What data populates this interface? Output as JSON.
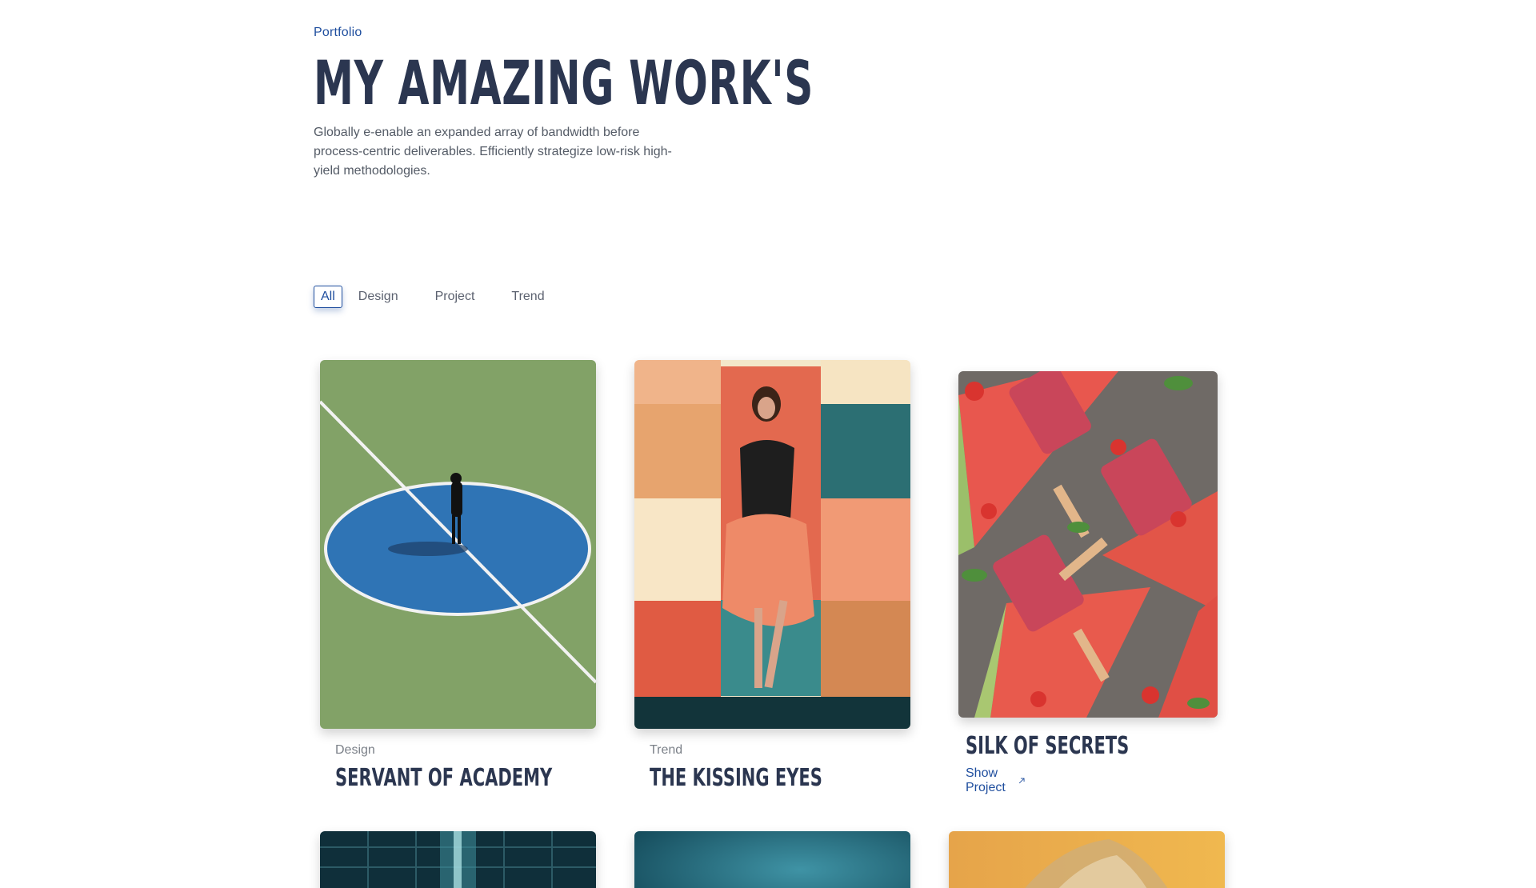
{
  "header": {
    "kicker": "Portfolio",
    "title": "MY AMAZING WORK'S",
    "description": "Globally e-enable an expanded array of bandwidth before process-centric deliverables. Efficiently strategize low-risk high-yield methodologies."
  },
  "filters": [
    {
      "label": "All",
      "active": true
    },
    {
      "label": "Design",
      "active": false
    },
    {
      "label": "Project",
      "active": false
    },
    {
      "label": "Trend",
      "active": false
    }
  ],
  "cards": [
    {
      "category": "Design",
      "title": "SERVANT OF ACADEMY",
      "image": "basketball-court-photo"
    },
    {
      "category": "Trend",
      "title": "THE KISSING EYES",
      "image": "woman-colorful-wall-photo"
    },
    {
      "title": "SILK OF SECRETS",
      "action_label": "Show Project",
      "image": "watermelon-popsicles-photo",
      "hovered": true
    }
  ],
  "second_row": [
    {
      "image": "dark-corridor-photo"
    },
    {
      "image": "teal-abstract-photo"
    },
    {
      "image": "golden-sand-photo"
    }
  ],
  "colors": {
    "accent": "#1f4e9e",
    "heading": "#2b3650",
    "muted": "#7b8088"
  }
}
